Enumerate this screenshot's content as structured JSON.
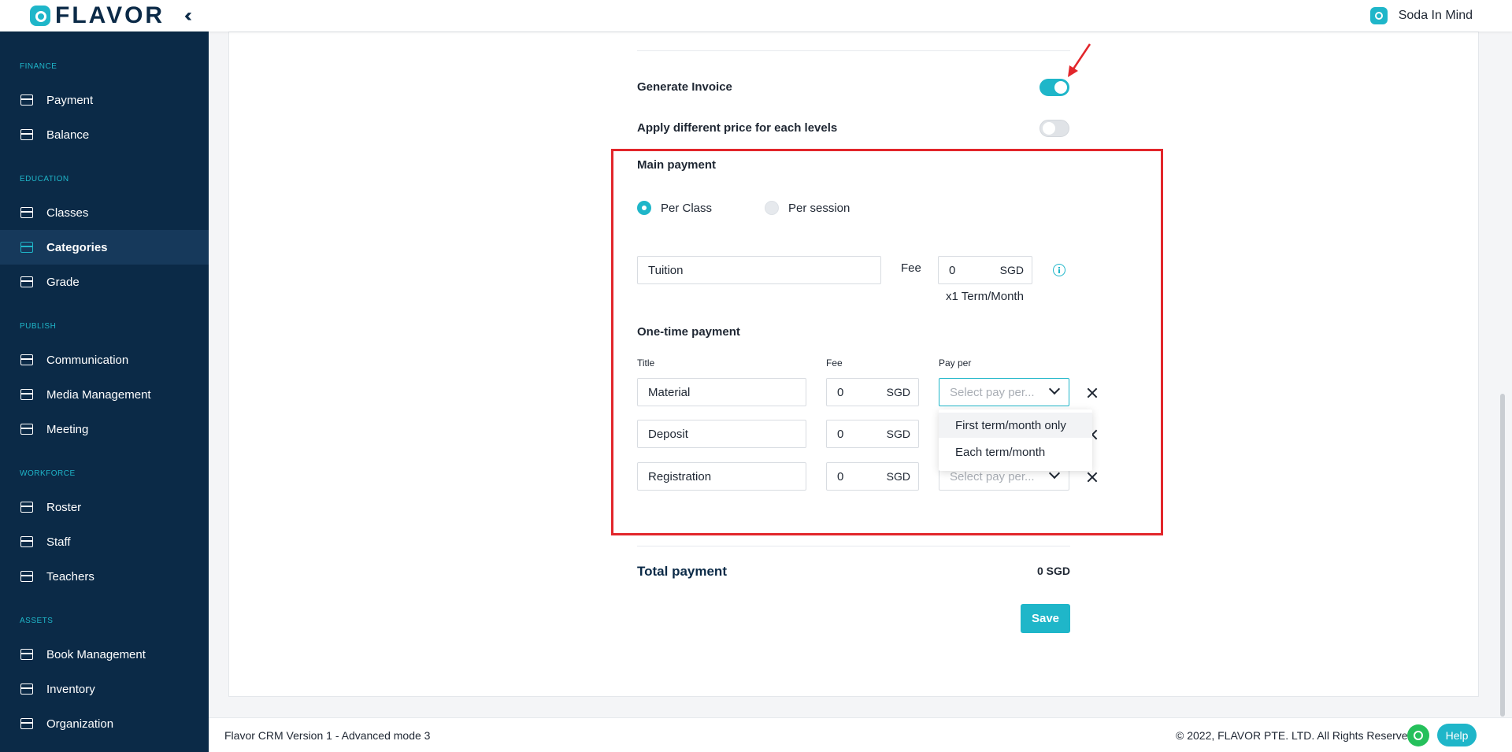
{
  "brand": {
    "name": "FLAVOR"
  },
  "org": {
    "name": "Soda In Mind"
  },
  "sidebar": {
    "sections": [
      {
        "title": "FINANCE",
        "items": [
          {
            "label": "Payment",
            "icon": "payment-icon"
          },
          {
            "label": "Balance",
            "icon": "balance-icon"
          }
        ]
      },
      {
        "title": "EDUCATION",
        "items": [
          {
            "label": "Classes",
            "icon": "classes-icon"
          },
          {
            "label": "Categories",
            "icon": "categories-icon",
            "active": true
          },
          {
            "label": "Grade",
            "icon": "grade-icon"
          }
        ]
      },
      {
        "title": "PUBLISH",
        "items": [
          {
            "label": "Communication",
            "icon": "communication-icon"
          },
          {
            "label": "Media Management",
            "icon": "media-icon"
          },
          {
            "label": "Meeting",
            "icon": "meeting-icon"
          }
        ]
      },
      {
        "title": "WORKFORCE",
        "items": [
          {
            "label": "Roster",
            "icon": "roster-icon"
          },
          {
            "label": "Staff",
            "icon": "staff-icon"
          },
          {
            "label": "Teachers",
            "icon": "teachers-icon"
          }
        ]
      },
      {
        "title": "ASSETS",
        "items": [
          {
            "label": "Book Management",
            "icon": "book-icon"
          },
          {
            "label": "Inventory",
            "icon": "inventory-icon"
          },
          {
            "label": "Organization",
            "icon": "organization-icon"
          }
        ]
      }
    ]
  },
  "form": {
    "generate_invoice": {
      "label": "Generate Invoice",
      "on": true
    },
    "apply_levels": {
      "label": "Apply different price for each levels",
      "on": false
    },
    "main_payment": {
      "title": "Main payment",
      "options": [
        {
          "label": "Per Class",
          "selected": true
        },
        {
          "label": "Per session",
          "selected": false
        }
      ],
      "tuition_title": "Tuition",
      "fee_label": "Fee",
      "fee_value": "0",
      "currency": "SGD",
      "multiplier": "x1 Term/Month"
    },
    "one_time": {
      "title": "One-time payment",
      "col_title": "Title",
      "col_fee": "Fee",
      "col_pay_per": "Pay per",
      "rows": [
        {
          "title": "Material",
          "fee": "0",
          "currency": "SGD",
          "pay_per_placeholder": "Select pay per..."
        },
        {
          "title": "Deposit",
          "fee": "0",
          "currency": "SGD",
          "pay_per_placeholder": "Select pay per..."
        },
        {
          "title": "Registration",
          "fee": "0",
          "currency": "SGD",
          "pay_per_placeholder": "Select pay per..."
        }
      ],
      "dropdown_options": [
        "First term/month only",
        "Each term/month"
      ]
    },
    "total": {
      "label": "Total payment",
      "value": "0 SGD"
    },
    "save_label": "Save"
  },
  "footer": {
    "version": "Flavor CRM Version 1 - Advanced mode 3",
    "copyright": "© 2022, FLAVOR PTE. LTD. All Rights Reserved.",
    "help_label": "Help"
  },
  "colors": {
    "accent": "#1fb6c9",
    "sidebar": "#0b2a47",
    "highlight": "#e2262b"
  }
}
